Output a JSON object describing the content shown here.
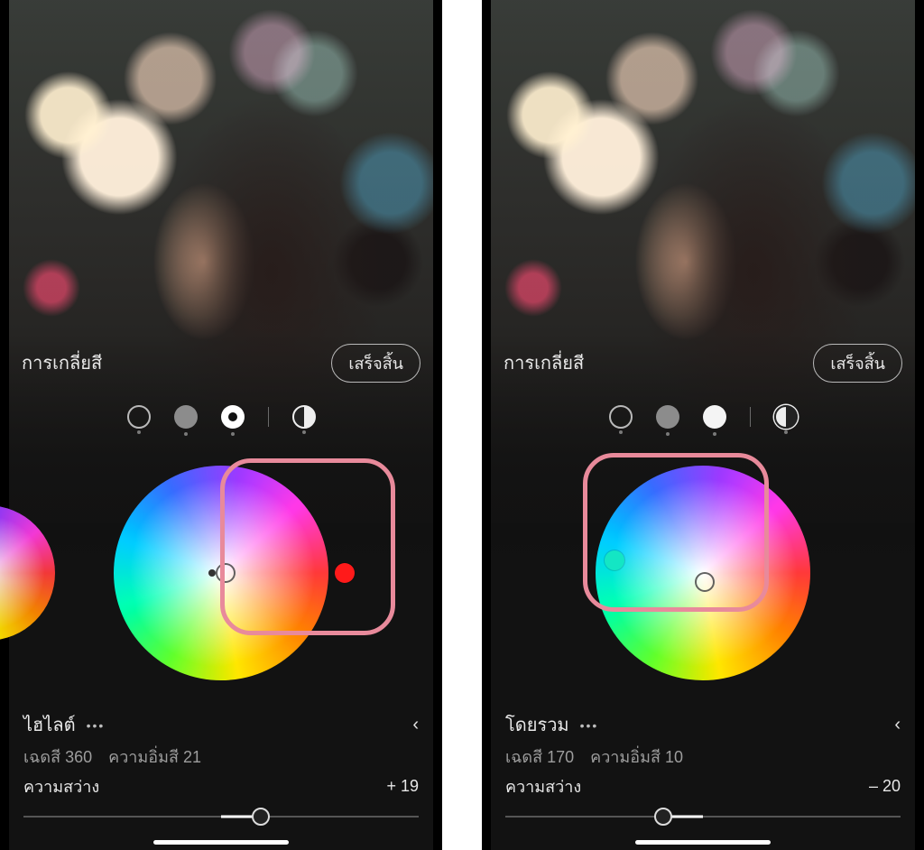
{
  "left": {
    "panel_title": "การเกลี่ยสี",
    "done_label": "เสร็จสิ้น",
    "tabs_active_index": 2,
    "section_name": "ไฮไลต์",
    "hue_label": "เฉดสี",
    "hue_value": "360",
    "sat_label": "ความอิ่มสี",
    "sat_value": "21",
    "lum_label": "ความสว่าง",
    "lum_value": "+ 19",
    "picker_hot_color": "#ff1a1a",
    "slider_pct": 60,
    "slider_fill_from": 50,
    "slider_fill_to": 60
  },
  "right": {
    "panel_title": "การเกลี่ยสี",
    "done_label": "เสร็จสิ้น",
    "tabs_active_index": 3,
    "section_name": "โดยรวม",
    "hue_label": "เฉดสี",
    "hue_value": "170",
    "sat_label": "ความอิ่มสี",
    "sat_value": "10",
    "lum_label": "ความสว่าง",
    "lum_value": "– 20",
    "picker_hot_color": "#14e6c4",
    "slider_pct": 40,
    "slider_fill_from": 40,
    "slider_fill_to": 50
  }
}
